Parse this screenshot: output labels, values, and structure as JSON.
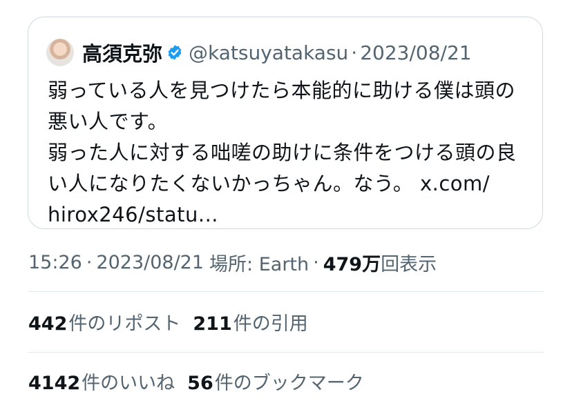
{
  "quoted_post": {
    "author_name": "高須克弥",
    "handle": "@katsuyatakasu",
    "separator": "·",
    "date": "2023/08/21",
    "body_lines": [
      "弱っている人を見つけたら本能的に助ける僕は頭の",
      "悪い人です。",
      "弱った人に対する咄嗟の助けに条件をつける頭の良",
      "い人になりたくないかっちゃん。なう。 x.com/",
      "hirox246/statu..."
    ]
  },
  "post_meta": {
    "time": "15:26",
    "sep1": "·",
    "date": "2023/08/21",
    "location_label": "場所: Earth",
    "sep2": "·",
    "views_count": "479万",
    "views_label": "回表示"
  },
  "stats_row1": {
    "reposts_count": "442",
    "reposts_label": "件のリポスト",
    "quotes_count": "211",
    "quotes_label": "件の引用"
  },
  "stats_row2": {
    "likes_count": "4142",
    "likes_label": "件のいいね",
    "bookmarks_count": "56",
    "bookmarks_label": "件のブックマーク"
  },
  "colors": {
    "text": "#0f1419",
    "secondary": "#536471",
    "verified": "#1d9bf0",
    "border": "#cfd9de"
  },
  "icons": {
    "verified": "verified-badge-icon"
  }
}
